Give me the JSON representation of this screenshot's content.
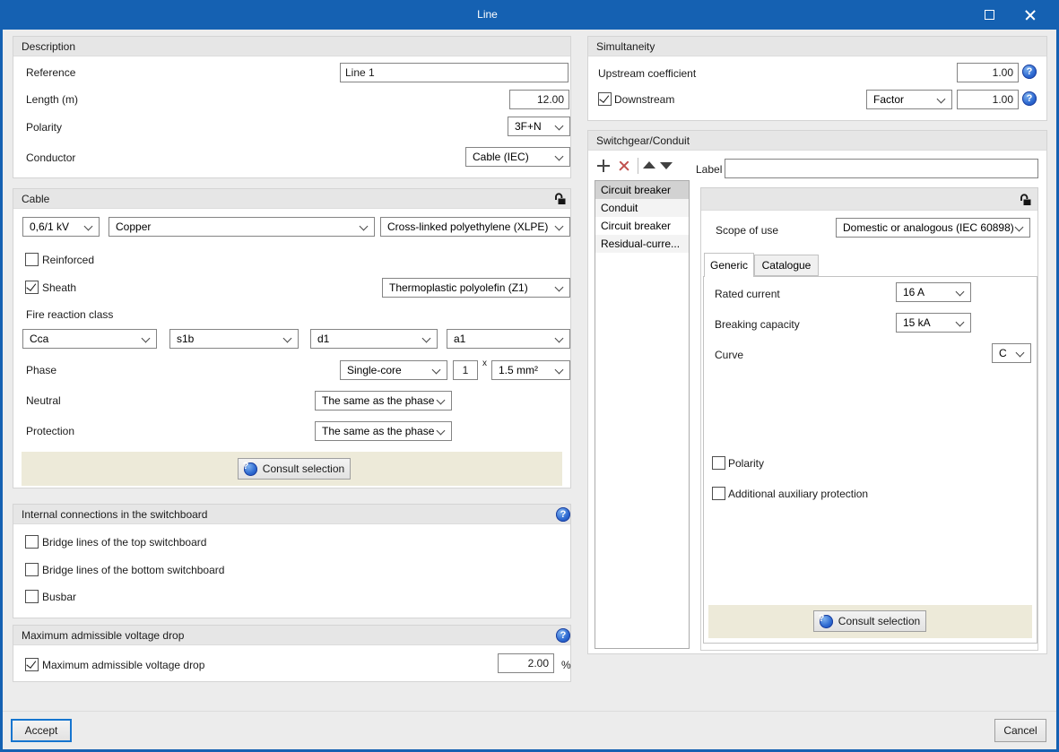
{
  "window": {
    "title": "Line"
  },
  "colors": {
    "titlebar": "#1561b2",
    "section_header": "#e6e6e6",
    "consult_strip": "#edead9",
    "delete_red": "#c0504d",
    "help_blue": "#2e6ad1",
    "focus_blue": "#1675cf",
    "selected_row": "#d2d2d2"
  },
  "description": {
    "title": "Description",
    "reference_label": "Reference",
    "reference_value": "Line 1",
    "length_label": "Length (m)",
    "length_value": "12.00",
    "polarity_label": "Polarity",
    "polarity_value": "3F+N",
    "conductor_label": "Conductor",
    "conductor_value": "Cable (IEC)"
  },
  "cable": {
    "title": "Cable",
    "voltage_value": "0,6/1 kV",
    "material_value": "Copper",
    "insulation_value": "Cross-linked polyethylene (XLPE)",
    "reinforced_label": "Reinforced",
    "sheath_label": "Sheath",
    "sheath_value": "Thermoplastic polyolefin (Z1)",
    "fire_class_label": "Fire reaction class",
    "fire_class": [
      "Cca",
      "s1b",
      "d1",
      "a1"
    ],
    "phase_label": "Phase",
    "phase_type_value": "Single-core",
    "phase_count_value": "1",
    "phase_times": "x",
    "phase_size_value": "1.5 mm²",
    "neutral_label": "Neutral",
    "neutral_value": "The same as the phase",
    "protection_label": "Protection",
    "protection_value": "The same as the phase",
    "consult_label": "Consult selection"
  },
  "internal": {
    "title": "Internal connections in the switchboard",
    "items": [
      "Bridge lines of the top switchboard",
      "Bridge lines of the bottom switchboard",
      "Busbar"
    ]
  },
  "voltage_drop": {
    "title": "Maximum admissible voltage drop",
    "checkbox_label": "Maximum admissible voltage drop",
    "value": "2.00",
    "unit": "%"
  },
  "simultaneity": {
    "title": "Simultaneity",
    "upstream_label": "Upstream coefficient",
    "upstream_value": "1.00",
    "downstream_label": "Downstream",
    "factor_value": "Factor",
    "factor_amount": "1.00"
  },
  "switchgear": {
    "title": "Switchgear/Conduit",
    "label_label": "Label",
    "label_value": "",
    "items": [
      {
        "label": "Circuit breaker",
        "selected": true
      },
      {
        "label": "Conduit",
        "selected": false
      },
      {
        "label": "Circuit breaker",
        "selected": false
      },
      {
        "label": "Residual-curre...",
        "selected": false
      }
    ],
    "scope_label": "Scope of use",
    "scope_value": "Domestic or analogous (IEC 60898)",
    "tabs": [
      {
        "label": "Generic",
        "active": true
      },
      {
        "label": "Catalogue",
        "active": false
      }
    ],
    "rated_label": "Rated current",
    "rated_value": "16 A",
    "breaking_label": "Breaking capacity",
    "breaking_value": "15 kA",
    "curve_label": "Curve",
    "curve_value": "C",
    "polarity_label": "Polarity",
    "aux_label": "Additional auxiliary protection",
    "consult_label": "Consult selection"
  },
  "footer": {
    "accept_label": "Accept",
    "cancel_label": "Cancel"
  }
}
